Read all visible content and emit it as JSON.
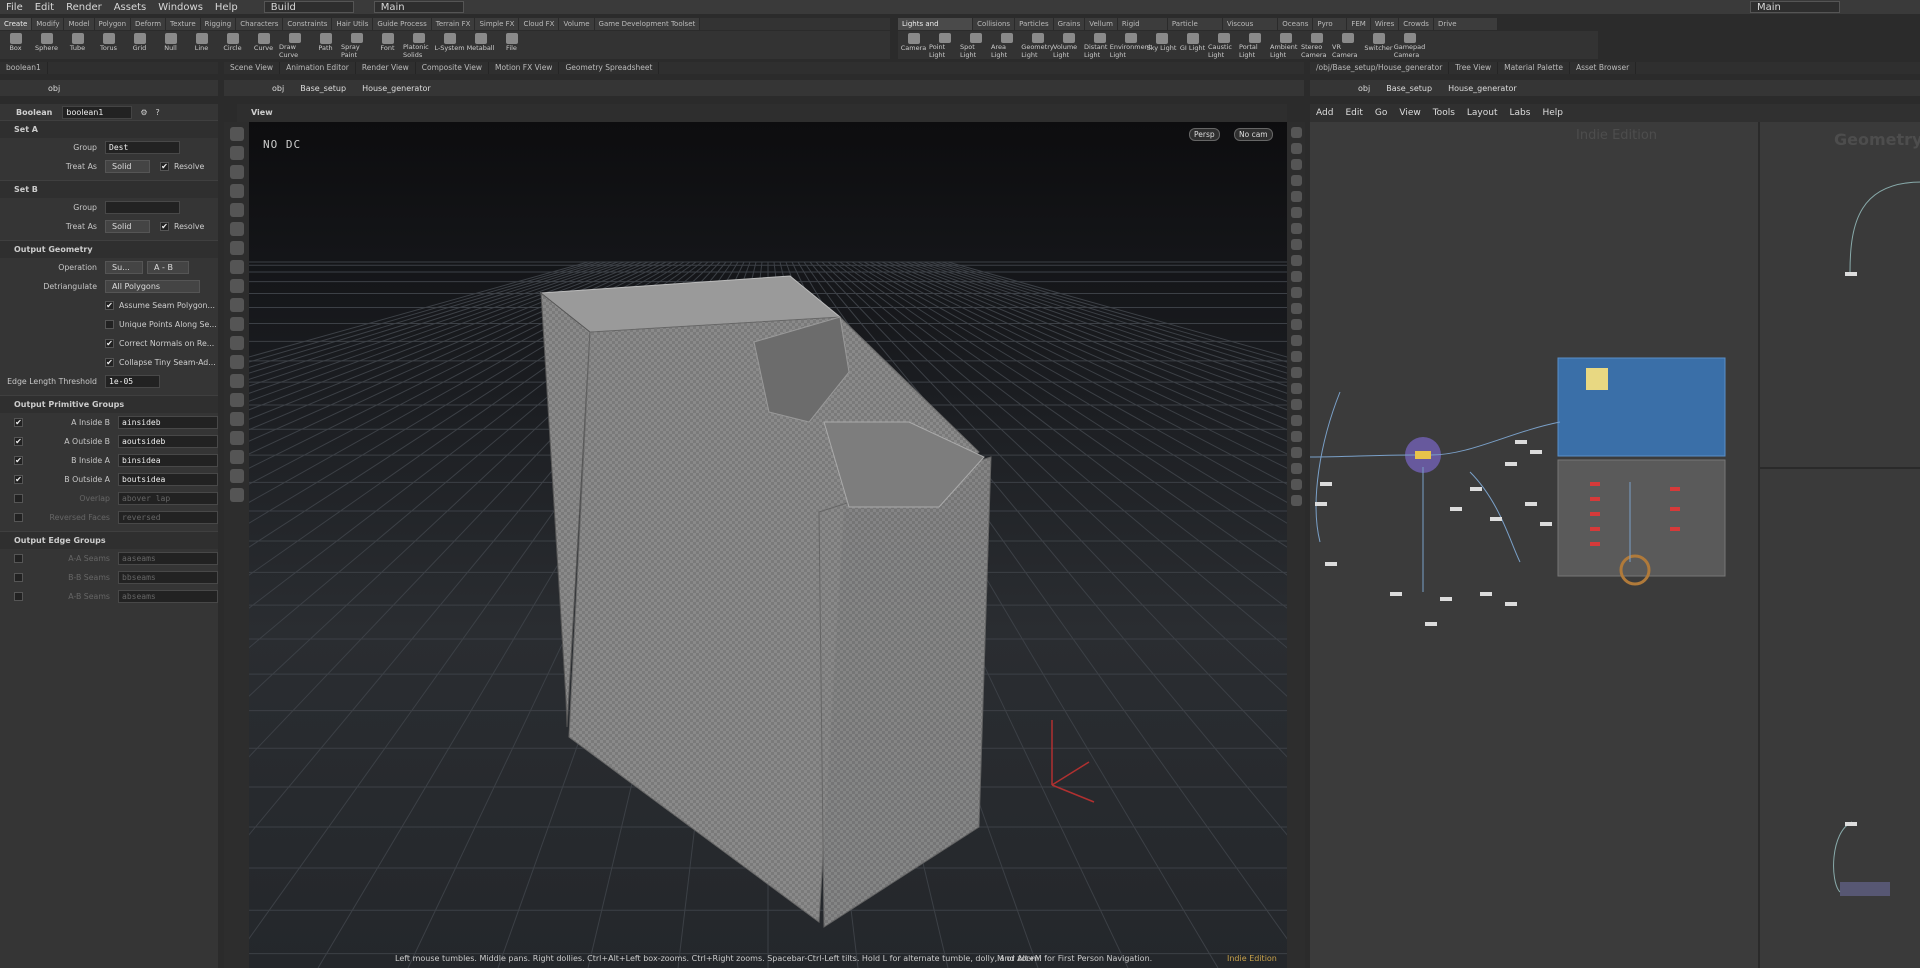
{
  "menubar": {
    "items": [
      "File",
      "Edit",
      "Render",
      "Assets",
      "Windows",
      "Help"
    ],
    "desktop": "Build",
    "main": "Main",
    "right_main": "Main"
  },
  "shelf_left": {
    "tabs": [
      "Create",
      "Modify",
      "Model",
      "Polygon",
      "Deform",
      "Texture",
      "Rigging",
      "Characters",
      "Constraints",
      "Hair Utils",
      "Guide Process",
      "Terrain FX",
      "Simple FX",
      "Cloud FX",
      "Volume",
      "Game Development Toolset"
    ],
    "tools": [
      "Box",
      "Sphere",
      "Tube",
      "Torus",
      "Grid",
      "Null",
      "Line",
      "Circle",
      "Curve",
      "Draw Curve",
      "Path",
      "Spray Paint",
      "Font",
      "Platonic Solids",
      "L-System",
      "Metaball",
      "File"
    ]
  },
  "shelf_right": {
    "tabs": [
      "Lights and Cameras",
      "Collisions",
      "Particles",
      "Grains",
      "Vellum",
      "Rigid Bodies",
      "Particle Fluids",
      "Viscous Fluids",
      "Oceans",
      "Pyro FX",
      "FEM",
      "Wires",
      "Crowds",
      "Drive Simulation"
    ],
    "tools": [
      "Camera",
      "Point Light",
      "Spot Light",
      "Area Light",
      "Geometry Light",
      "Volume Light",
      "Distant Light",
      "Environment Light",
      "Sky Light",
      "GI Light",
      "Caustic Light",
      "Portal Light",
      "Ambient Light",
      "Stereo Camera",
      "VR Camera",
      "Switcher",
      "Gamepad Camera"
    ]
  },
  "panes": {
    "left_tab": "boolean1",
    "center_tabs": [
      "Scene View",
      "Animation Editor",
      "Render View",
      "Composite View",
      "Motion FX View",
      "Geometry Spreadsheet"
    ],
    "right_tabs": [
      "/obj/Base_setup/House_generator",
      "Tree View",
      "Material Palette",
      "Asset Browser"
    ]
  },
  "paths": {
    "left": "obj",
    "center": [
      "obj",
      "Base_setup",
      "House_generator"
    ],
    "right": [
      "obj",
      "Base_setup",
      "House_generator"
    ]
  },
  "params": {
    "node_type": "Boolean",
    "node_name": "boolean1",
    "set_a": "Set A",
    "set_b": "Set B",
    "group_label": "Group",
    "treat_as_label": "Treat As",
    "group_a_value": "Dest",
    "treat_a_value": "Solid",
    "treat_b_value": "Solid",
    "resolve_label": "Resolve",
    "output_geometry": "Output Geometry",
    "operation_label": "Operation",
    "operation_value": "Su...",
    "operation_value2": "A - B",
    "detriangulate_label": "Detriangulate",
    "detriangulate_value": "All Polygons",
    "checks": [
      "Assume Seam Polygon...",
      "Unique Points Along Se...",
      "Correct Normals on Re...",
      "Collapse Tiny Seam-Ad..."
    ],
    "edge_threshold_label": "Edge Length Threshold",
    "edge_threshold_value": "1e-05",
    "output_prim_groups": "Output Primitive Groups",
    "prim_groups": [
      {
        "label": "A Inside B",
        "value": "ainsideb"
      },
      {
        "label": "A Outside B",
        "value": "aoutsideb"
      },
      {
        "label": "B Inside A",
        "value": "binsidea"
      },
      {
        "label": "B Outside A",
        "value": "boutsidea"
      },
      {
        "label": "Overlap",
        "value": "abover lap"
      },
      {
        "label": "Reversed Faces",
        "value": "reversed"
      }
    ],
    "output_edge_groups": "Output Edge Groups",
    "edge_groups": [
      {
        "label": "A-A Seams",
        "value": "aaseams"
      },
      {
        "label": "B-B Seams",
        "value": "bbseams"
      },
      {
        "label": "A-B Seams",
        "value": "abseams"
      }
    ]
  },
  "viewport": {
    "title": "View",
    "overlay": "NO DC",
    "persp": "Persp",
    "cam": "No cam",
    "hint": "Left mouse tumbles. Middle pans. Right dollies. Ctrl+Alt+Left box-zooms. Ctrl+Right zooms. Spacebar-Ctrl-Left tilts. Hold L for alternate tumble, dolly, and zoom.",
    "hint2": "M or Alt+M for First Person Navigation.",
    "edition": "Indie Edition"
  },
  "network": {
    "menu": [
      "Add",
      "Edit",
      "Go",
      "View",
      "Tools",
      "Layout",
      "Labs",
      "Help"
    ],
    "watermark": "Indie Edition",
    "context_label": "Geometry"
  }
}
